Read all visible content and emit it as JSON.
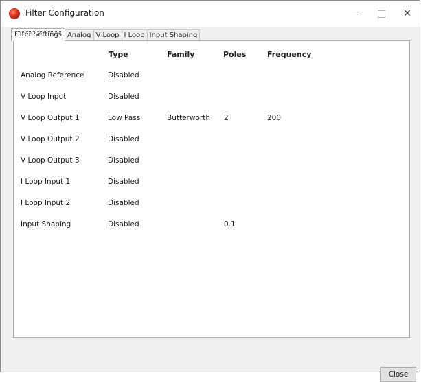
{
  "window": {
    "title": "Filter Configuration",
    "minimize_label": "—",
    "close_glyph": "✕"
  },
  "tabs": [
    {
      "label": "Filter Settings",
      "active": true
    },
    {
      "label": "Analog",
      "active": false
    },
    {
      "label": "V Loop",
      "active": false
    },
    {
      "label": "I Loop",
      "active": false
    },
    {
      "label": "Input Shaping",
      "active": false
    }
  ],
  "table": {
    "headers": [
      "Type",
      "Family",
      "Poles",
      "Frequency"
    ],
    "rows": [
      {
        "name": "Analog Reference",
        "type": "Disabled",
        "family": "",
        "poles": "",
        "frequency": ""
      },
      {
        "name": "V Loop Input",
        "type": "Disabled",
        "family": "",
        "poles": "",
        "frequency": ""
      },
      {
        "name": "V Loop Output 1",
        "type": "Low Pass",
        "family": "Butterworth",
        "poles": "2",
        "frequency": "200"
      },
      {
        "name": "V Loop Output 2",
        "type": "Disabled",
        "family": "",
        "poles": "",
        "frequency": ""
      },
      {
        "name": "V Loop Output 3",
        "type": "Disabled",
        "family": "",
        "poles": "",
        "frequency": ""
      },
      {
        "name": "I Loop Input 1",
        "type": "Disabled",
        "family": "",
        "poles": "",
        "frequency": ""
      },
      {
        "name": "I Loop Input 2",
        "type": "Disabled",
        "family": "",
        "poles": "",
        "frequency": ""
      },
      {
        "name": "Input Shaping",
        "type": "Disabled",
        "family": "",
        "poles": "0.1",
        "frequency": ""
      }
    ]
  },
  "footer": {
    "close_label": "Close"
  },
  "colors": {
    "app_icon": "#e0301b",
    "window_bg": "#f0f0f0",
    "panel_bg": "#ffffff"
  }
}
